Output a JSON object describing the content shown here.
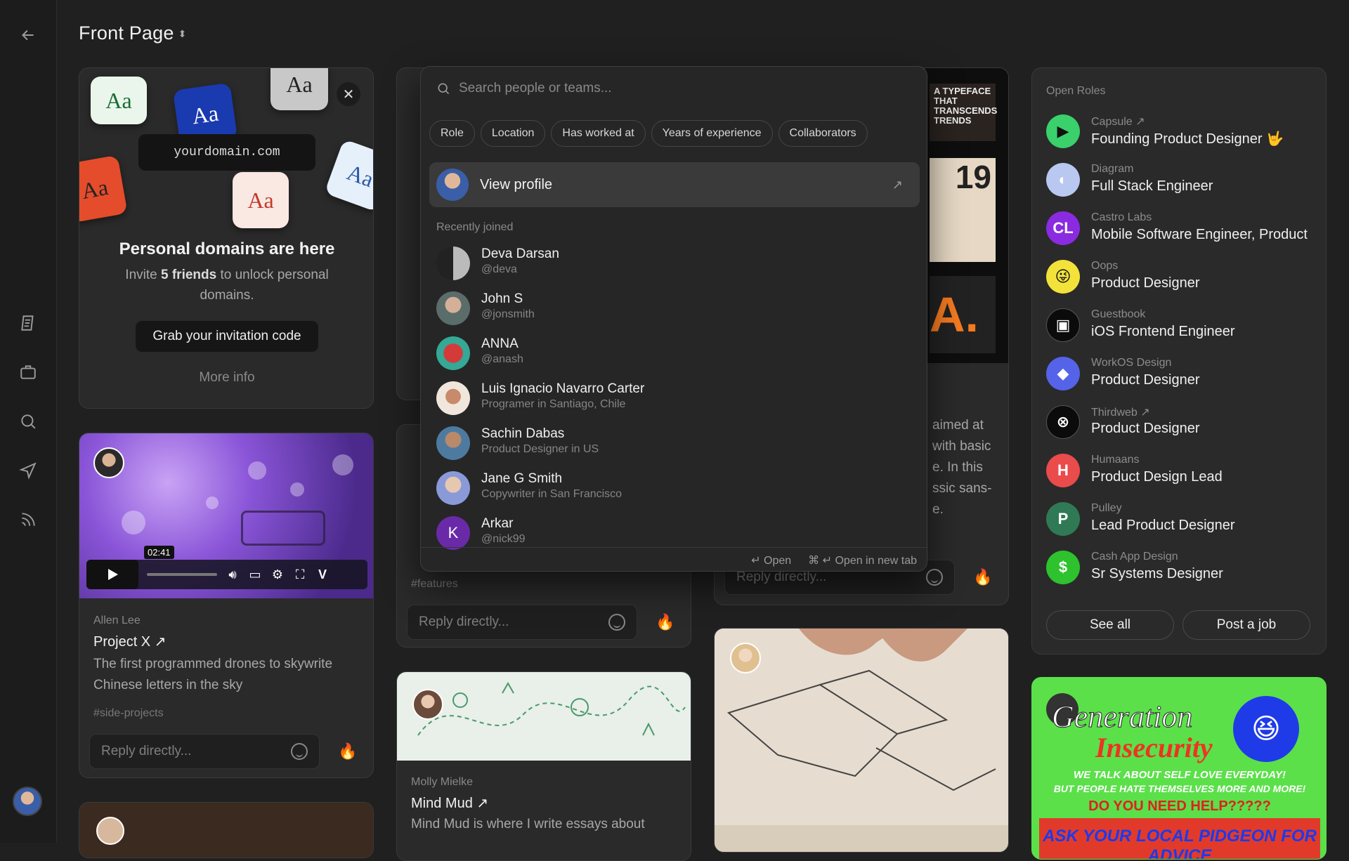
{
  "header": {
    "title": "Front Page"
  },
  "sidebar": {
    "icons": [
      "back-arrow-icon",
      "notes-icon",
      "briefcase-icon",
      "search-icon",
      "send-icon",
      "rss-icon"
    ]
  },
  "domain_card": {
    "url": "yourdomain.com",
    "aa_label": "Aa",
    "title": "Personal domains are here",
    "body_pre": "Invite ",
    "body_bold": "5 friends",
    "body_post": " to unlock personal domains.",
    "cta": "Grab your invitation code",
    "more": "More info"
  },
  "video_card": {
    "time": "02:41",
    "author": "Allen Lee",
    "title": "Project X ↗",
    "body": "The first programmed drones to skywrite Chinese letters in the sky",
    "tag": "#side-projects",
    "reply_placeholder": "Reply directly..."
  },
  "card_b": {
    "tag": "#features",
    "reply_placeholder": "Reply directly..."
  },
  "card_c": {
    "text_lines": [
      "aimed at",
      "with basic",
      "e. In this",
      "ssic sans-",
      "e."
    ],
    "reply_placeholder": "Reply directly...",
    "poster_text": "A TYPEFACE THAT TRANSCENDS TRENDS",
    "poster_num": "19",
    "poster_big": "A."
  },
  "mindmud_card": {
    "author": "Molly Mielke",
    "title": "Mind Mud ↗",
    "body": "Mind Mud is where I write essays about"
  },
  "open_roles": {
    "heading": "Open Roles",
    "roles": [
      {
        "company": "Capsule ↗",
        "title": "Founding Product Designer 🤟",
        "logo": "▶",
        "color": "#3ad06b"
      },
      {
        "company": "Diagram",
        "title": "Full Stack Engineer",
        "logo": "◐",
        "color": "#b8c8f0"
      },
      {
        "company": "Castro Labs",
        "title": "Mobile Software Engineer, Product",
        "logo": "CL",
        "color": "#8a2be2"
      },
      {
        "company": "Oops",
        "title": "Product Designer",
        "logo": "😜",
        "color": "#f3e23a"
      },
      {
        "company": "Guestbook",
        "title": "iOS Frontend Engineer",
        "logo": "▣",
        "color": "#0b0b0b"
      },
      {
        "company": "WorkOS Design",
        "title": "Product Designer",
        "logo": "◆",
        "color": "#5563e8"
      },
      {
        "company": "Thirdweb ↗",
        "title": "Product Designer",
        "logo": "⊗",
        "color": "#0b0b0b"
      },
      {
        "company": "Humaans",
        "title": "Product Design Lead",
        "logo": "H",
        "color": "#ea4b4b"
      },
      {
        "company": "Pulley",
        "title": "Lead Product Designer",
        "logo": "P",
        "color": "#2f7a55"
      },
      {
        "company": "Cash App Design",
        "title": "Sr Systems Designer",
        "logo": "$",
        "color": "#2ec22e"
      }
    ],
    "see_all": "See all",
    "post_job": "Post a job"
  },
  "poster_card": {
    "line1": "Generation",
    "line2": "Insecurity",
    "line3": "WE TALK ABOUT SELF LOVE EVERYDAY!",
    "line4": "BUT PEOPLE HATE THEMSELVES MORE AND MORE!",
    "line5": "DO YOU NEED HELP?????",
    "line6": "ASK YOUR LOCAL PIDGEON FOR ADVICE"
  },
  "popup": {
    "search_placeholder": "Search people or teams...",
    "filters": [
      "Role",
      "Location",
      "Has worked at",
      "Years of experience",
      "Collaborators"
    ],
    "view_profile": "View profile",
    "recent_heading": "Recently joined",
    "people": [
      {
        "name": "Deva Darsan",
        "sub": "@deva",
        "color": "#777",
        "initial": ""
      },
      {
        "name": "John S",
        "sub": "@jonsmith",
        "color": "#5b6d6a",
        "initial": ""
      },
      {
        "name": "ANNA",
        "sub": "@anash",
        "color": "#d33b3b",
        "initial": ""
      },
      {
        "name": "Luis Ignacio Navarro Carter",
        "sub": "Programer in Santiago, Chile",
        "color": "#f0e6dc",
        "initial": ""
      },
      {
        "name": "Sachin Dabas",
        "sub": "Product Designer in US",
        "color": "#4e7aa0",
        "initial": ""
      },
      {
        "name": "Jane G Smith",
        "sub": "Copywriter in San Francisco",
        "color": "#8a9ad8",
        "initial": ""
      },
      {
        "name": "Arkar",
        "sub": "@nick99",
        "color": "#6a2aa8",
        "initial": "K"
      }
    ],
    "footer_open": "↵ Open",
    "footer_newtab": "⌘ ↵ Open in new tab"
  }
}
